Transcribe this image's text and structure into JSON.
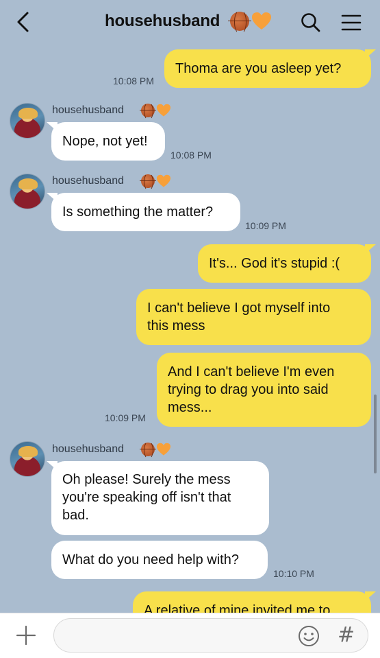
{
  "header": {
    "title": "househusband",
    "back_icon": "chevron-left-icon",
    "search_icon": "search-icon",
    "menu_icon": "hamburger-menu-icon",
    "title_emoji": [
      "basketball-emoji",
      "orange-heart-emoji"
    ]
  },
  "contact": {
    "name": "househusband",
    "emoji": [
      "basketball-emoji",
      "orange-heart-emoji"
    ]
  },
  "messages": [
    {
      "from": "me",
      "text": "Thoma are you asleep yet?",
      "time": "10:08 PM"
    },
    {
      "from": "them",
      "text": "Nope, not yet!",
      "time": "10:08 PM"
    },
    {
      "from": "them",
      "text": "Is something the matter?",
      "time": "10:09 PM"
    },
    {
      "from": "me",
      "text": "It's... God it's stupid :("
    },
    {
      "from": "me",
      "lines": [
        "I can't believe I got myself into",
        "this mess"
      ]
    },
    {
      "from": "me",
      "lines": [
        "And I can't believe I'm even",
        "trying to drag you into said",
        "mess..."
      ],
      "time": "10:09 PM"
    },
    {
      "from": "them",
      "lines": [
        "Oh please! Surely the mess",
        "you're speaking off isn't that",
        "bad."
      ]
    },
    {
      "from": "them",
      "text": "What do you need help with?",
      "time": "10:10 PM"
    },
    {
      "from": "me",
      "text": "A relative of mine invited me to"
    }
  ],
  "composer": {
    "placeholder": "",
    "plus_icon": "plus-icon",
    "emoji_icon": "smiley-icon",
    "hashtag": "#"
  },
  "colors": {
    "background": "#aabccf",
    "my_bubble": "#f8e04b",
    "their_bubble": "#ffffff"
  }
}
